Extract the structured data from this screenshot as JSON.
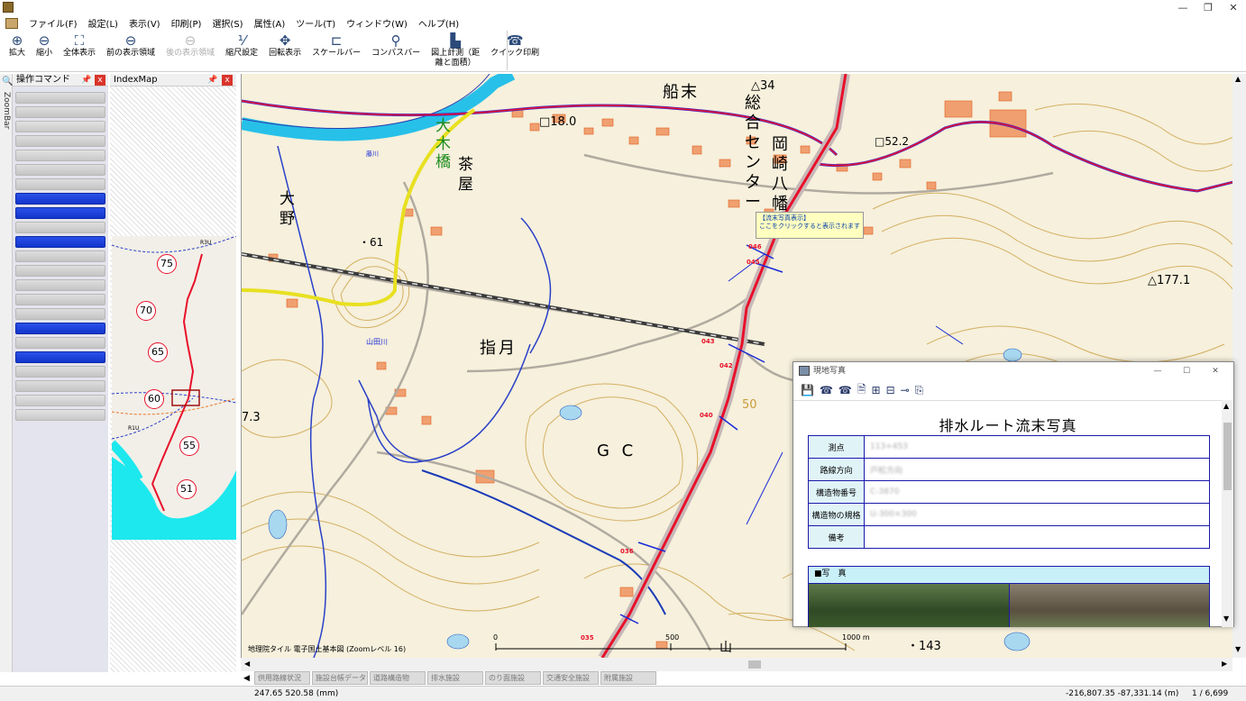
{
  "menubar": {
    "items": [
      "ファイル(F)",
      "設定(L)",
      "表示(V)",
      "印刷(P)",
      "選択(S)",
      "属性(A)",
      "ツール(T)",
      "ウィンドウ(W)",
      "ヘルプ(H)"
    ]
  },
  "toolbar": {
    "buttons": [
      {
        "label": "拡大",
        "icon": "zoom-in-icon"
      },
      {
        "label": "縮小",
        "icon": "zoom-out-icon"
      },
      {
        "label": "全体表示",
        "icon": "fit-all-icon"
      },
      {
        "label": "前の表示領域",
        "icon": "prev-view-icon"
      },
      {
        "label": "後の表示領域",
        "icon": "next-view-icon",
        "disabled": true
      },
      {
        "label": "縮尺設定",
        "icon": "scale-set-icon"
      },
      {
        "label": "回転表示",
        "icon": "rotate-icon"
      },
      {
        "label": "スケールバー",
        "icon": "scalebar-icon"
      },
      {
        "label": "コンパスバー",
        "icon": "compass-icon"
      },
      {
        "label": "図上計測（距離と面積）",
        "line1": "図上計測（距",
        "line2": "離と面積）",
        "icon": "measure-icon"
      },
      {
        "label": "クイック印刷",
        "icon": "print-icon"
      }
    ]
  },
  "dock": {
    "zoombar_label": "ZoomBar"
  },
  "panels": {
    "commands": {
      "title": "操作コマンド",
      "pin": "📌",
      "close": "x"
    },
    "indexmap": {
      "title": "IndexMap",
      "pin": "📌",
      "close": "x",
      "road": "R3U",
      "road2": "R1U",
      "markers": [
        "75",
        "70",
        "65",
        "60",
        "55",
        "51"
      ]
    }
  },
  "map": {
    "labels": {
      "funamatsu": "船末",
      "okazaki": "岡崎八幡",
      "sogo": "総合センター",
      "triangle34": "△34",
      "b180": "□18.0",
      "b522": "□52.2",
      "oki": "大木橋",
      "chaya": "茶屋",
      "ono": "大野",
      "dot61": "・61",
      "triangle1771": "△177.1",
      "sashitsuki": "指月",
      "gc": "G C",
      "n73": "7.3",
      "dot143": "・143",
      "n50": "50",
      "yama": "山",
      "yamadagawa": "山田川",
      "fuji": "藤川"
    },
    "route_points": [
      "043",
      "042",
      "040",
      "036",
      "035",
      "045",
      "046"
    ],
    "callout": {
      "title": "【流末写真表示】",
      "body": "ここをクリックすると表示されます"
    },
    "scalebar": {
      "zero": "0",
      "mid": "500",
      "max": "1000 m"
    },
    "attribution": "地理院タイル 電子国土基本図 (Zoomレベル 16)"
  },
  "photo_window": {
    "title": "現地写真",
    "heading": "排水ルート流末写真",
    "fields": [
      {
        "key": "測点",
        "value": "113+453"
      },
      {
        "key": "路線方向",
        "value": "戸松方向"
      },
      {
        "key": "構造物番号",
        "value": "C-3870"
      },
      {
        "key": "構造物の規格",
        "value": "U-300×300"
      },
      {
        "key": "備考",
        "value": ""
      }
    ],
    "photo_section": "■写　真"
  },
  "tabs": [
    "供用路線状況",
    "施設台帳データ",
    "道路構造物",
    "排水施設",
    "のり面施設",
    "交通安全施設",
    "附属施設"
  ],
  "status": {
    "coord1": "247.65 520.58 (mm)",
    "coord2": "-216,807.35 -87,331.14 (m)",
    "scale": "1 / 6,699"
  },
  "colors": {
    "command_blue": "#1a3ee0",
    "route_red": "#e8102a",
    "river_cyan": "#27c0e8",
    "table_border": "#1a1aaa"
  }
}
